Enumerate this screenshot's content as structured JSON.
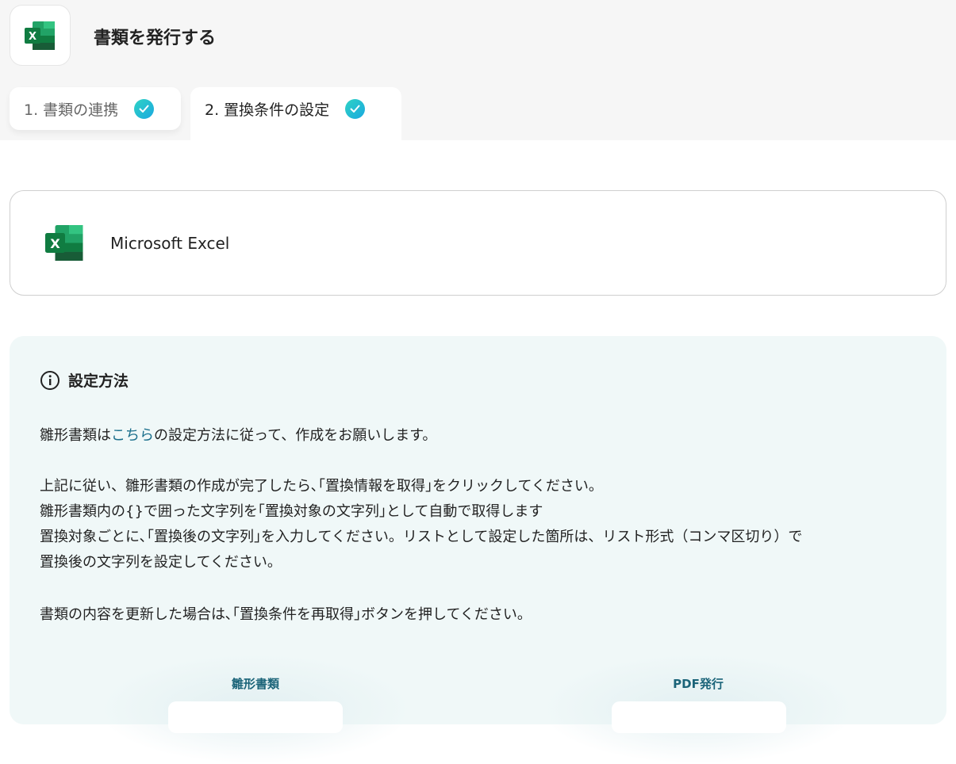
{
  "header": {
    "title": "書類を発行する"
  },
  "tabs": [
    {
      "label": "1. 書類の連携",
      "completed": true
    },
    {
      "label": "2. 置換条件の設定",
      "completed": true
    }
  ],
  "app_card": {
    "name": "Microsoft Excel",
    "icon": "excel-icon"
  },
  "info": {
    "heading": "設定方法",
    "line1_pre": "雛形書類は",
    "line1_link": "こちら",
    "line1_post": "の設定方法に従って、作成をお願いします。",
    "para2": [
      "上記に従い、雛形書類の作成が完了したら､｢置換情報を取得｣をクリックしてください。",
      "雛形書類内の{}で囲った文字列を｢置換対象の文字列｣として自動で取得します",
      "置換対象ごとに､｢置換後の文字列｣を入力してください。リストとして設定した箇所は、リスト形式（コンマ区切り）で",
      "置換後の文字列を設定してください。"
    ],
    "para3": "書類の内容を更新した場合は､｢置換条件を再取得｣ボタンを押してください。",
    "diagram": {
      "left_label": "雛形書類",
      "right_label": "PDF発行"
    }
  },
  "colors": {
    "accent": "#1b6f8c",
    "check": "#1fbfd4",
    "excel": "#107c41"
  }
}
